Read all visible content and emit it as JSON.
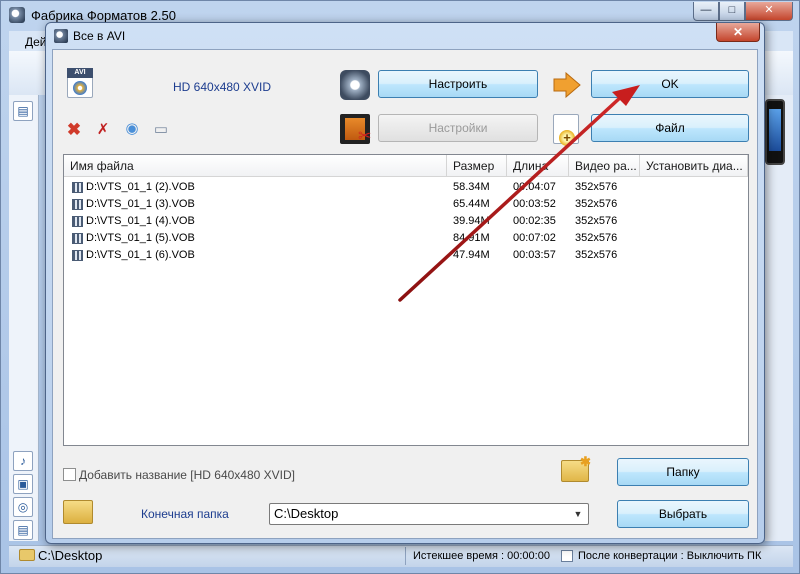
{
  "main_window": {
    "title": "Фабрика Форматов 2.50",
    "menu_partial": "Дей",
    "min_glyph": "—",
    "max_glyph": "□",
    "close_glyph": "✕"
  },
  "status_bar": {
    "path": "C:\\Desktop",
    "elapsed": "Истекшее время : 00:00:00",
    "after_conversion": "После конвертации : Выключить ПК"
  },
  "dialog": {
    "title": "Все в AVI",
    "close_glyph": "✕",
    "profile_tag": "AVI",
    "profile_label": "HD 640x480 XVID",
    "buttons": {
      "configure": "Настроить",
      "settings": "Настройки",
      "ok": "OK",
      "file": "Файл",
      "folder": "Папку",
      "choose": "Выбрать"
    },
    "table": {
      "columns": [
        "Имя файла",
        "Размер",
        "Длина",
        "Видео ра...",
        "Установить диа..."
      ],
      "rows": [
        {
          "name": "D:\\VTS_01_1 (2).VOB",
          "size": "58.34M",
          "length": "00:04:07",
          "video": "352x576"
        },
        {
          "name": "D:\\VTS_01_1 (3).VOB",
          "size": "65.44M",
          "length": "00:03:52",
          "video": "352x576"
        },
        {
          "name": "D:\\VTS_01_1 (4).VOB",
          "size": "39.94M",
          "length": "00:02:35",
          "video": "352x576"
        },
        {
          "name": "D:\\VTS_01_1 (5).VOB",
          "size": "84.91M",
          "length": "00:07:02",
          "video": "352x576"
        },
        {
          "name": "D:\\VTS_01_1 (6).VOB",
          "size": "47.94M",
          "length": "00:03:57",
          "video": "352x576"
        }
      ]
    },
    "add_title_label": "Добавить название [HD 640x480 XVID]",
    "dest_label": "Конечная папка",
    "dest_value": "C:\\Desktop",
    "dropdown_glyph": "▼"
  },
  "icons": {
    "remove": "✖",
    "clear": "✗",
    "play": "◉",
    "info": "▭",
    "scissors": "✂",
    "plus": "+",
    "star": "✱",
    "music": "♪",
    "picture": "▣",
    "disc": "◎",
    "grid": "▤"
  },
  "colors": {
    "accent_text": "#1d3d8f",
    "annotation_arrow": "#b01818"
  }
}
